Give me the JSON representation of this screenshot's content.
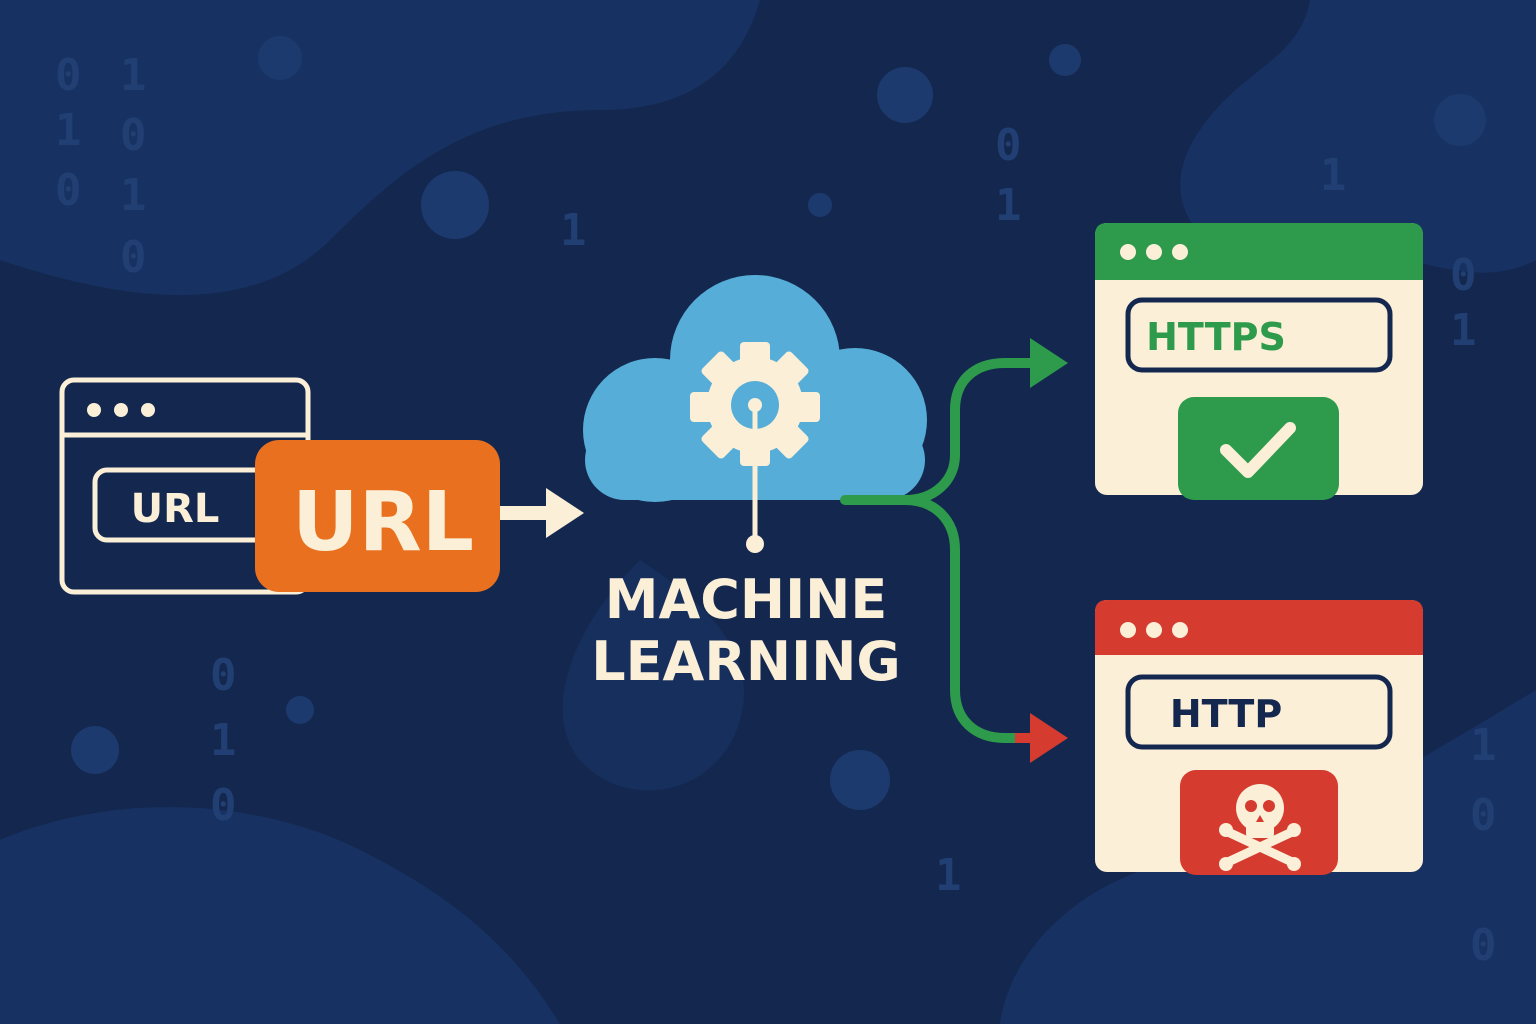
{
  "input_window": {
    "field_label": "URL",
    "badge_label": "URL"
  },
  "classifier": {
    "title_line1": "MACHINE",
    "title_line2": "LEARNING"
  },
  "safe_result": {
    "field_label": "HTTPS",
    "status_icon": "check-icon"
  },
  "unsafe_result": {
    "field_label": "HTTP",
    "status_icon": "skull-crossbones-icon"
  },
  "background_binary": [
    "0",
    "1",
    "0",
    "1",
    "0",
    "1",
    "0",
    "1",
    "0",
    "1",
    "1",
    "0",
    "1",
    "0",
    "1",
    "0",
    "1",
    "0",
    "1",
    "0"
  ],
  "colors": {
    "background": "#14284f",
    "cream": "#fbefd8",
    "orange": "#e8701f",
    "cloud": "#56aed8",
    "green": "#2d9b4b",
    "red": "#d53b2f"
  }
}
